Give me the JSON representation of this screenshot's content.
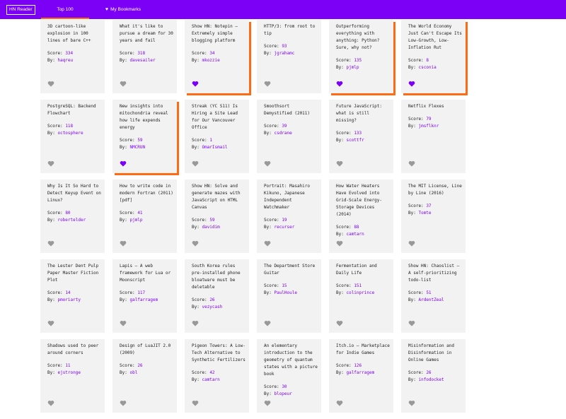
{
  "header": {
    "logo": "HN Reader",
    "tabs": [
      {
        "label": "Top 100",
        "active": true
      },
      {
        "label": "My Bookmarks",
        "icon": "heart-icon"
      }
    ]
  },
  "labels": {
    "score": "Score:",
    "by": "By:"
  },
  "colors": {
    "brand": "#7b00f5",
    "accent": "#ff6a13",
    "heart_off": "#999999",
    "heart_on": "#7b00f5"
  },
  "stories": [
    {
      "title": "3D cartoon-like explosion in 100 lines of bare C++",
      "score": "334",
      "by": "haqreu",
      "bookmarked": false
    },
    {
      "title": "What it's like to pursue a dream for 30 years and fail",
      "score": "318",
      "by": "davesailer",
      "bookmarked": false
    },
    {
      "title": "Show HN: Notepin – Extremely simple blogging platform",
      "score": "34",
      "by": "mkozzie",
      "bookmarked": true
    },
    {
      "title": "HTTP/3: from root to tip",
      "score": "93",
      "by": "jgrahamc",
      "bookmarked": false
    },
    {
      "title": "Outperforming everything with anything: Python? Sure, why not?",
      "score": "135",
      "by": "pjmlp",
      "bookmarked": true
    },
    {
      "title": "The World Economy Just Can't Escape Its Low-Growth, Low-Inflation Rut",
      "score": "8",
      "by": "csconia",
      "bookmarked": true
    },
    {
      "title": "PostgreSQL: Backend Flowchart",
      "score": "118",
      "by": "octosphere",
      "bookmarked": false
    },
    {
      "title": "New insights into mitochondria reveal how life expends energy",
      "score": "59",
      "by": "NMCRUN",
      "bookmarked": true
    },
    {
      "title": "Streak (YC S11) Is Hiring a Site Lead for Our Vancouver Office",
      "score": "1",
      "by": "OmarIsmail",
      "bookmarked": false
    },
    {
      "title": "Smoothsort Demystified (2011)",
      "score": "39",
      "by": "csdrane",
      "bookmarked": false
    },
    {
      "title": "Future JavaScript: what is still missing?",
      "score": "133",
      "by": "scottfr",
      "bookmarked": false
    },
    {
      "title": "Netflix Flexes",
      "score": "79",
      "by": "jmsflknr",
      "bookmarked": false
    },
    {
      "title": "Why Is It So Hard to Detect Keyup Event on Linux?",
      "score": "80",
      "by": "robertelder",
      "bookmarked": false
    },
    {
      "title": "How to write code in modern Fortran (2011) [pdf]",
      "score": "41",
      "by": "pjmlp",
      "bookmarked": false
    },
    {
      "title": "Show HN: Solve and generate mazes with JavaScript on HTML Canvas",
      "score": "59",
      "by": "davidim",
      "bookmarked": false
    },
    {
      "title": "Portrait: Masahiro Kikuno, Japanese Independent Watchmaker",
      "score": "19",
      "by": "recurser",
      "bookmarked": false
    },
    {
      "title": "How Water Heaters Have Evolved into Grid-Scale Energy-Storage Devices (2014)",
      "score": "88",
      "by": "camtarn",
      "bookmarked": false
    },
    {
      "title": "The MIT License, Line by Line (2016)",
      "score": "37",
      "by": "Tomte",
      "bookmarked": false
    },
    {
      "title": "The Lester Dent Pulp Paper Master Fiction Plot",
      "score": "14",
      "by": "pmoriarty",
      "bookmarked": false
    },
    {
      "title": "Lapis – A web framework for Lua or Moonscript",
      "score": "117",
      "by": "galfarragem",
      "bookmarked": false
    },
    {
      "title": "South Korea rules pre-installed phone bloatware must be deletable",
      "score": "26",
      "by": "vezycash",
      "bookmarked": false
    },
    {
      "title": "The Department Store Guitar",
      "score": "15",
      "by": "PaulHoule",
      "bookmarked": false
    },
    {
      "title": "Fermentation and Daily Life",
      "score": "151",
      "by": "colinprince",
      "bookmarked": false
    },
    {
      "title": "Show HN: Chaoslist – A self-prioritizing todo-list",
      "score": "51",
      "by": "ArdentZeal",
      "bookmarked": false
    },
    {
      "title": "Shadows used to peer around corners",
      "score": "11",
      "by": "ejstronge",
      "bookmarked": false
    },
    {
      "title": "Design of LuaJIT 2.0 (2009)",
      "score": "26",
      "by": "obl",
      "bookmarked": false
    },
    {
      "title": "Pigeon Towers: A Low-Tech Alternative to Synthetic Fertilizers",
      "score": "42",
      "by": "camtarn",
      "bookmarked": false
    },
    {
      "title": "An elementary introduction to the geometry of quantum states with a picture book",
      "score": "30",
      "by": "blopeur",
      "bookmarked": false
    },
    {
      "title": "Itch.io – Marketplace for Indie Games",
      "score": "126",
      "by": "galfarragem",
      "bookmarked": false
    },
    {
      "title": "Misinformation and Disinformation in Online Games",
      "score": "26",
      "by": "infodocket",
      "bookmarked": false
    }
  ]
}
